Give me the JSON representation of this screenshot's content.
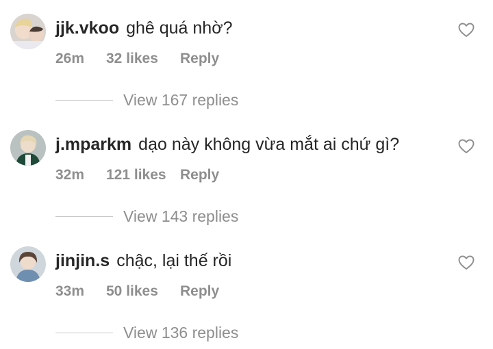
{
  "comments": [
    {
      "username": "jjk.vkoo",
      "text": "ghê quá nhờ?",
      "time": "26m",
      "likes": "32 likes",
      "reply": "Reply",
      "view_replies": "View 167 replies",
      "avatar_icon": "avatar-photo",
      "like_icon": "heart-outline-icon"
    },
    {
      "username": "j.mparkm",
      "text": "dạo này không vừa mắt ai chứ gì?",
      "time": "32m",
      "likes": "121 likes",
      "reply": "Reply",
      "view_replies": "View 143 replies",
      "avatar_icon": "avatar-photo",
      "like_icon": "heart-outline-icon"
    },
    {
      "username": "jinjin.s",
      "text": "chậc, lại thế rồi",
      "time": "33m",
      "likes": "50 likes",
      "reply": "Reply",
      "view_replies": "View 136 replies",
      "avatar_icon": "avatar-photo",
      "like_icon": "heart-outline-icon"
    }
  ],
  "colors": {
    "text": "#262626",
    "secondary": "#8e8e8e",
    "divider": "#c7c7c7"
  }
}
